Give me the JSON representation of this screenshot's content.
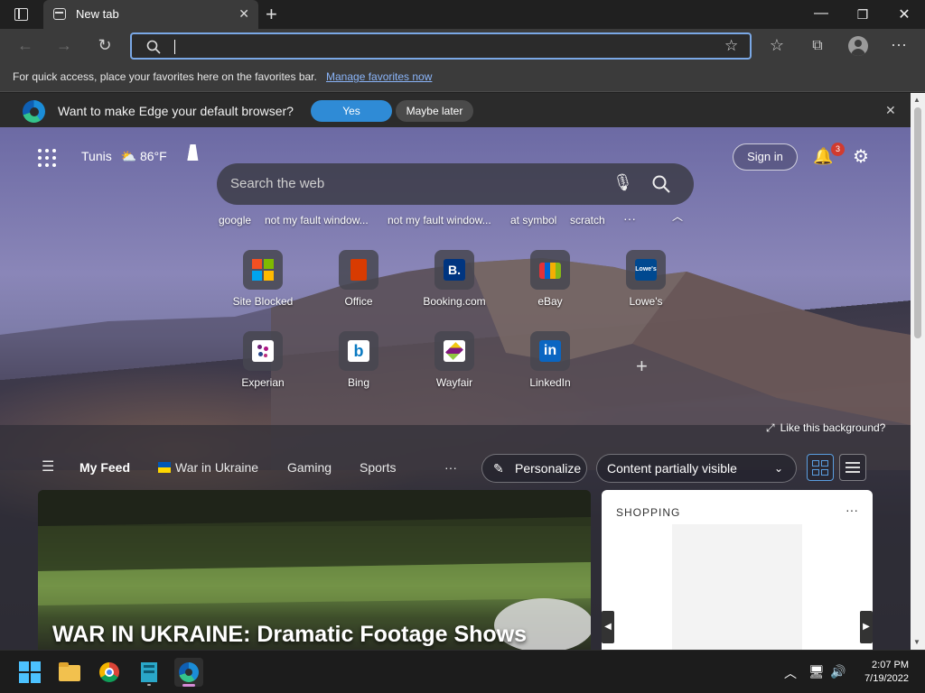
{
  "browser": {
    "tab_title": "New tab",
    "favorites_prompt": "For quick access, place your favorites here on the favorites bar.",
    "manage_favorites": "Manage favorites now",
    "address_value": "",
    "default_prompt": "Want to make Edge your default browser?",
    "yes_label": "Yes",
    "maybe_later_label": "Maybe later"
  },
  "newtab": {
    "location": "Tunis",
    "temperature": "86°F",
    "sign_in": "Sign in",
    "notification_count": "3",
    "search_placeholder": "Search the web",
    "trending": [
      "google",
      "not my fault window...",
      "not my fault window...",
      "at symbol",
      "scratch"
    ],
    "more": "···",
    "tiles": [
      {
        "label": "Site Blocked",
        "icon": "windows-logo"
      },
      {
        "label": "Office",
        "icon": "office-logo"
      },
      {
        "label": "Booking.com",
        "icon": "booking-logo",
        "glyph": "B."
      },
      {
        "label": "eBay",
        "icon": "ebay-bag"
      },
      {
        "label": "Lowe's",
        "icon": "lowes-logo",
        "glyph": "Lowe's"
      },
      {
        "label": "Experian",
        "icon": "experian-logo"
      },
      {
        "label": "Bing",
        "icon": "bing-logo",
        "glyph": "b"
      },
      {
        "label": "Wayfair",
        "icon": "wayfair-logo"
      },
      {
        "label": "LinkedIn",
        "icon": "linkedin-logo",
        "glyph": "in"
      }
    ],
    "like_background": "Like this background?"
  },
  "feed": {
    "tabs": [
      "My Feed",
      "War in Ukraine",
      "Gaming",
      "Sports"
    ],
    "more": "···",
    "personalize": "Personalize",
    "visibility": "Content partially visible",
    "headline": "WAR IN UKRAINE: Dramatic Footage Shows",
    "shopping_header": "SHOPPING",
    "shopping_more": "···"
  },
  "taskbar": {
    "time": "2:07 PM",
    "date": "7/19/2022"
  }
}
